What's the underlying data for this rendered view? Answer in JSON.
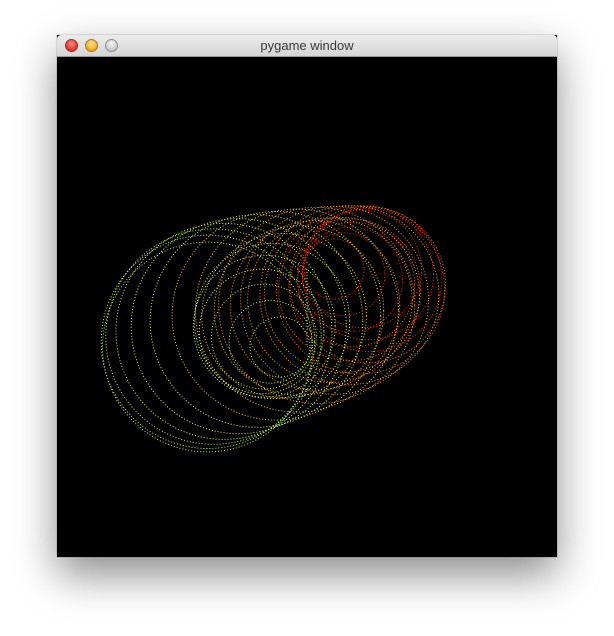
{
  "window": {
    "title": "pygame window",
    "controls": {
      "close_color": "#e0443a",
      "minimize_color": "#f2b53a",
      "zoom_color": "#cfcfcf"
    }
  },
  "canvas": {
    "background": "#000000",
    "palette": [
      "#ff2a00",
      "#ff6a10",
      "#ffa020",
      "#ffd040",
      "#e8ff50",
      "#b8ff60"
    ]
  }
}
